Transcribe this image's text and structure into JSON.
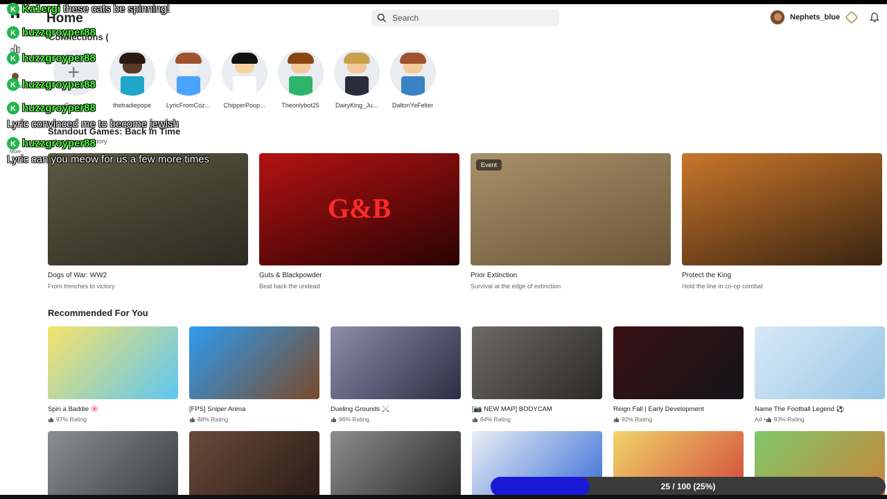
{
  "header": {
    "page_title": "Home",
    "search_placeholder": "Search",
    "username": "Nephets_blue"
  },
  "sidebar": {
    "items": [
      {
        "label": "",
        "icon": "home-icon"
      },
      {
        "label": "",
        "icon": "charts-icon"
      },
      {
        "label": "Avatar",
        "icon": "avatar-icon"
      },
      {
        "label": "More",
        "icon": "more-icon"
      }
    ]
  },
  "connections": {
    "title": "Connections (",
    "connect_label": "Connect",
    "friends": [
      {
        "name": "thetradiepope",
        "skin": "#5a3a2a",
        "hair": "#2a1a12",
        "torso": "#1fa6c9"
      },
      {
        "name": "LyricFromCoz...",
        "skin": "#f2f2f2",
        "hair": "#a0522d",
        "torso": "#4aa3ff"
      },
      {
        "name": "ChipperPoop...",
        "skin": "#f5d3a0",
        "hair": "#111111",
        "torso": "#ffffff"
      },
      {
        "name": "Theonlybot25",
        "skin": "#f4c99b",
        "hair": "#8b4513",
        "torso": "#2fb56b"
      },
      {
        "name": "DairyKing_Ju...",
        "skin": "#f0c89a",
        "hair": "#c9a14b",
        "torso": "#2b2b3b"
      },
      {
        "name": "DaltonYeFelter",
        "skin": "#f4c99b",
        "hair": "#a0522d",
        "torso": "#3b82c4"
      }
    ]
  },
  "standout": {
    "title": "Standout Games: Back in Time",
    "subtitle": "veling through history",
    "items": [
      {
        "title": "Dogs of War: WW2",
        "subtitle": "From trenches to victory",
        "c1": "#5b5a43",
        "c2": "#2c2b1f",
        "badge": ""
      },
      {
        "title": "Guts & Blackpowder",
        "subtitle": "Beat back the undead",
        "c1": "#b51212",
        "c2": "#2a0303",
        "badge": ""
      },
      {
        "title": "Prior Extinction",
        "subtitle": "Survival at the edge of extinction",
        "c1": "#a8916a",
        "c2": "#6b5536",
        "badge": "Event"
      },
      {
        "title": "Protect the King",
        "subtitle": "Hold the line in co-op combat",
        "c1": "#c9762b",
        "c2": "#3a2410",
        "badge": ""
      }
    ],
    "center_art_text": "G&B"
  },
  "recommended": {
    "title": "Recommended For You",
    "row1": [
      {
        "title": "Spin a Baddie 🌸",
        "rating": "97% Rating",
        "prefix": "",
        "c1": "#f7e36b",
        "c2": "#5ec6f2"
      },
      {
        "title": "[FPS] Sniper Arena",
        "rating": "88% Rating",
        "prefix": "",
        "c1": "#2e9cf0",
        "c2": "#7a4a2a"
      },
      {
        "title": "Dueling Grounds ⚔️",
        "rating": "96% Rating",
        "prefix": "",
        "c1": "#8a8ea8",
        "c2": "#2b2e44"
      },
      {
        "title": "[📷 NEW MAP] BODYCAM",
        "rating": "84% Rating",
        "prefix": "",
        "c1": "#6d6a63",
        "c2": "#2c2a26"
      },
      {
        "title": "Reign Fall | Early Development",
        "rating": "92% Rating",
        "prefix": "",
        "c1": "#3a1014",
        "c2": "#141418"
      },
      {
        "title": "Name The Football  Legend ⚽",
        "rating": "83% Rating",
        "prefix": "Ad • ",
        "c1": "#d7e9f7",
        "c2": "#9ac6e6"
      }
    ],
    "row2": [
      {
        "c1": "#8a8f96",
        "c2": "#3b3e42"
      },
      {
        "c1": "#6b4a3a",
        "c2": "#2a1c15"
      },
      {
        "c1": "#8e8e8e",
        "c2": "#2a2a2a"
      },
      {
        "c1": "#e9eef6",
        "c2": "#3b6fd6"
      },
      {
        "c1": "#f2d56b",
        "c2": "#d14a3b"
      },
      {
        "c1": "#7fc86a",
        "c2": "#c9843b"
      }
    ]
  },
  "chat": [
    {
      "user": "Ka1ergi",
      "msg": " these cats be spinning!",
      "badge": true
    },
    {
      "user": "huzzgroyper88",
      "msg": "",
      "badge": true
    },
    {
      "user": "huzzgroyper88",
      "msg": "",
      "badge": true
    },
    {
      "user": "huzzgroyper88",
      "msg": "",
      "badge": true
    },
    {
      "user": "huzzgroyper88",
      "msg": "",
      "badge": true
    },
    {
      "user": "",
      "msg": "Lyric convinced me to become jewish",
      "badge": false
    },
    {
      "user": "huzzgroyper88",
      "msg": "",
      "badge": true
    },
    {
      "user": "",
      "msg": "Lyric can you meow for us a few more times",
      "badge": false
    }
  ],
  "progress": {
    "label": "25 / 100 (25%)",
    "fraction": 0.25
  },
  "colors": {
    "accent": "#1a1ad6",
    "chat_user": "#4cff3d",
    "chat_badge": "#28b44a"
  }
}
